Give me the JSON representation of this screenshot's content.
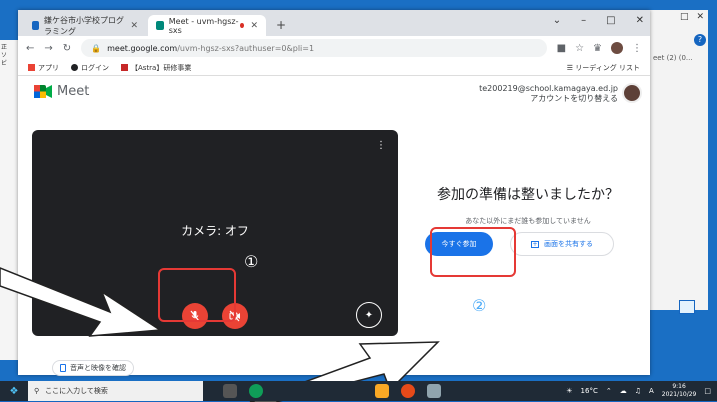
{
  "desktop": {
    "left_window_text": "正　ソ　ビ",
    "right_window_text": "eet (2) (0..."
  },
  "browser": {
    "tabs": [
      {
        "label": "鎌ケ谷市小学校プログラミング",
        "active": false
      },
      {
        "label": "Meet - uvm-hgsz-sxs",
        "active": true
      }
    ],
    "new_tab": "+",
    "window_controls": {
      "minimize": "–",
      "maximize": "□",
      "close": "✕"
    },
    "url_host": "meet.google.com",
    "url_path": "/uvm-hgsz-sxs?authuser=0&pli=1",
    "bookmarks": [
      {
        "label": "アプリ",
        "color": "#ea4335"
      },
      {
        "label": "ログイン",
        "color": "#202124"
      },
      {
        "label": "【Astra】研修事業",
        "color": "#c62828"
      }
    ],
    "reading_list": "リーディング リスト"
  },
  "meet": {
    "logo_text": "Meet",
    "account_email": "te200219@school.kamagaya.ed.jp",
    "switch_account": "アカウントを切り替える",
    "camera_status": "カメラ: オフ",
    "ready_title": "参加の準備は整いましたか？",
    "nobody_text": "あなた以外にまだ誰も参加していません",
    "join_button": "今すぐ参加",
    "share_button": "画面を共有する",
    "check_av": "音声と映像を確認"
  },
  "annotations": {
    "marker1": "①",
    "marker2": "②",
    "box_color": "#e53935",
    "marker2_color": "#4dabf7"
  },
  "taskbar": {
    "search_placeholder": "ここに入力して検索",
    "temperature": "16°C",
    "time": "9:16",
    "date": "2021/10/29",
    "ime": "A"
  },
  "colors": {
    "accent": "#1a73e8",
    "mute_red": "#ea4335",
    "desktop_blue": "#1a6fc4"
  }
}
